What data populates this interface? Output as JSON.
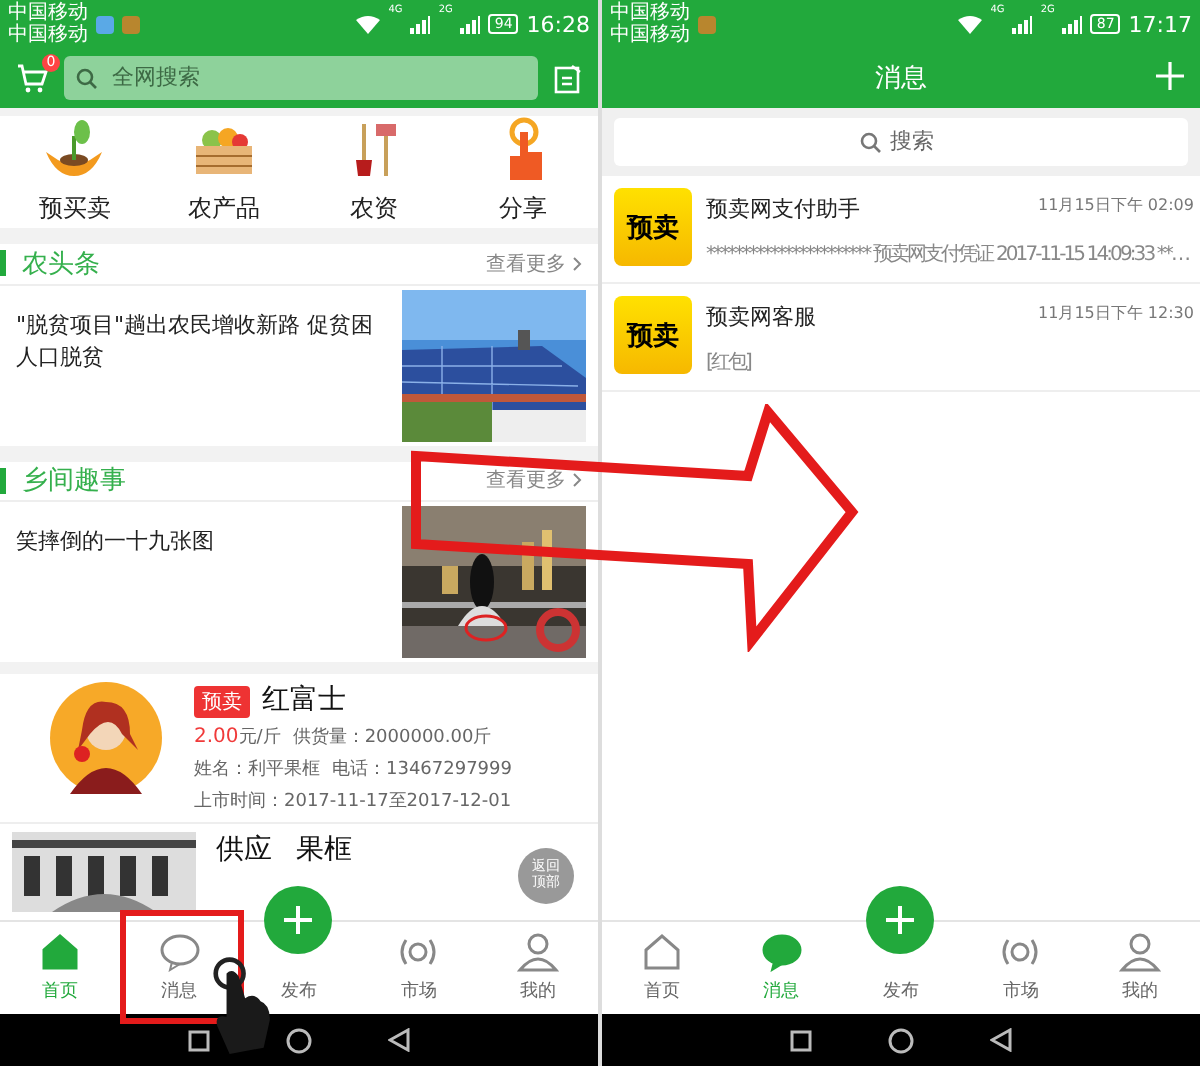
{
  "left_phone": {
    "status_bar": {
      "carriers": [
        "中国移动",
        "中国移动"
      ],
      "notification_icons": [
        {
          "color": "#5aa9e6"
        },
        {
          "color": "#b8862e"
        }
      ],
      "networks": [
        "4G",
        "2G"
      ],
      "battery": "94",
      "time": "16:28"
    },
    "header": {
      "cart_badge": "0",
      "search": {
        "placeholder": "全网搜索"
      }
    },
    "categories": [
      {
        "label": "预买卖",
        "kind": "sprout"
      },
      {
        "label": "农产品",
        "kind": "crate"
      },
      {
        "label": "农资",
        "kind": "tools"
      },
      {
        "label": "分享",
        "kind": "tap"
      }
    ],
    "sections": [
      {
        "title": "农头条",
        "more": "查看更多",
        "article": {
          "title": "\"脱贫项目\"趟出农民增收新路 促贫困人口脱贫"
        }
      },
      {
        "title": "乡间趣事",
        "more": "查看更多",
        "article": {
          "title": "笑摔倒的一十九张图"
        }
      }
    ],
    "products": [
      {
        "kind": "detail",
        "badge": "预卖",
        "title": "红富士",
        "price": "2.00",
        "unit": "元/斤",
        "supply": "供货量：2000000.00斤",
        "seller": "姓名：利平果框",
        "phone": "电话：13467297999",
        "dates": "上市时间：2017-11-17至2017-12-01"
      },
      {
        "kind": "brief",
        "title_parts": [
          "供应",
          "果框"
        ]
      }
    ],
    "back_to_top": "返回顶部",
    "nav": [
      {
        "label": "首页",
        "kind": "home",
        "selected": true
      },
      {
        "label": "消息",
        "kind": "chat",
        "selected": false
      },
      {
        "label": "发布",
        "kind": "publish",
        "selected": false
      },
      {
        "label": "市场",
        "kind": "market",
        "selected": false
      },
      {
        "label": "我的",
        "kind": "profile",
        "selected": false
      }
    ]
  },
  "right_phone": {
    "status_bar": {
      "carriers": [
        "中国移动",
        "中国移动"
      ],
      "notification_icons": [
        {
          "color": "#b8862e"
        }
      ],
      "networks": [
        "4G",
        "2G"
      ],
      "battery": "87",
      "time": "17:17"
    },
    "header": {
      "title": "消息"
    },
    "search": {
      "placeholder": "搜索"
    },
    "chats": [
      {
        "avatar_text": "预卖",
        "name": "预卖网支付助手",
        "time": "11月15日下午 02:09",
        "preview": "*********************** 预卖网支付凭证  2017-11-15 14:09:33 **…"
      },
      {
        "avatar_text": "预卖",
        "name": "预卖网客服",
        "time": "11月15日下午 12:30",
        "preview": "[红包]"
      }
    ],
    "nav": [
      {
        "label": "首页",
        "kind": "home",
        "selected": false
      },
      {
        "label": "消息",
        "kind": "chat",
        "selected": true
      },
      {
        "label": "发布",
        "kind": "publish",
        "selected": false
      },
      {
        "label": "市场",
        "kind": "market",
        "selected": false
      },
      {
        "label": "我的",
        "kind": "profile",
        "selected": false
      }
    ]
  }
}
